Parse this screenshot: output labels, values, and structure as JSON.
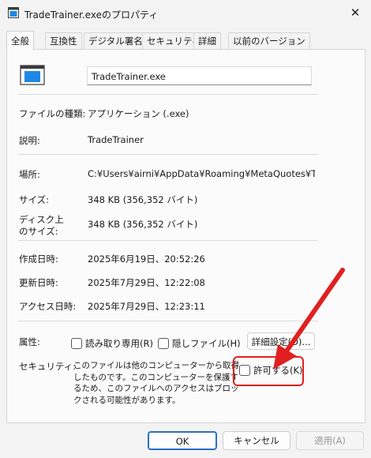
{
  "window": {
    "title": "TradeTrainer.exeのプロパティ",
    "close_icon": "✕"
  },
  "tabs": [
    {
      "label": "全般",
      "active": true
    },
    {
      "label": "互換性"
    },
    {
      "label": "デジタル署名"
    },
    {
      "label": "セキュリティ"
    },
    {
      "label": "詳細"
    },
    {
      "label": "以前のバージョン"
    }
  ],
  "general": {
    "file_name": "TradeTrainer.exe",
    "type_label": "ファイルの種類:",
    "type_value": "アプリケーション (.exe)",
    "desc_label": "説明:",
    "desc_value": "TradeTrainer",
    "location_label": "場所:",
    "location_value": "C:¥Users¥airni¥AppData¥Roaming¥MetaQuotes¥Terminal",
    "size_label": "サイズ:",
    "size_value": "348 KB (356,352 バイト)",
    "disk_size_label_1": "ディスク上",
    "disk_size_label_2": "のサイズ:",
    "disk_size_value": "348 KB (356,352 バイト)",
    "created_label": "作成日時:",
    "created_value": "2025年6月19日、20:52:26",
    "modified_label": "更新日時:",
    "modified_value": "2025年7月29日、12:22:08",
    "accessed_label": "アクセス日時:",
    "accessed_value": "2025年7月29日、12:23:11",
    "attributes_label": "属性:",
    "readonly_label": "読み取り専用(R)",
    "hidden_label": "隠しファイル(H)",
    "advanced_button": "詳細設定(D)...",
    "security_label": "セキュリティ:",
    "security_text": "このファイルは他のコンピューターから取得したものです。このコンピューターを保護するため、このファイルへのアクセスはブロックされる可能性があります。",
    "allow_label": "許可する(K)"
  },
  "buttons": {
    "ok": "OK",
    "cancel": "キャンセル",
    "apply": "適用(A)"
  },
  "colors": {
    "highlight": "#e02020",
    "accent": "#2d6fc6"
  }
}
